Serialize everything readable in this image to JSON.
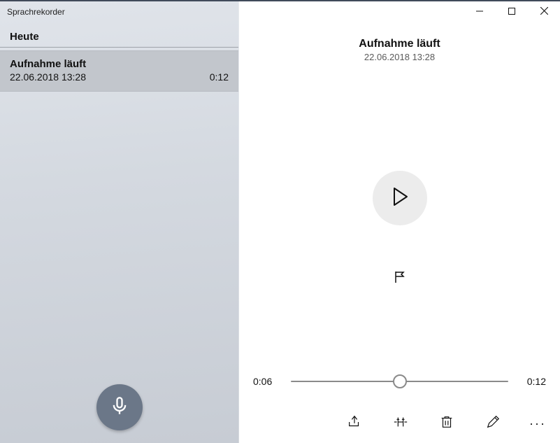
{
  "app_title": "Sprachrekorder",
  "sidebar": {
    "section_heading": "Heute",
    "recordings": [
      {
        "title": "Aufnahme läuft",
        "datetime": "22.06.2018 13:28",
        "duration": "0:12"
      }
    ]
  },
  "detail": {
    "title": "Aufnahme läuft",
    "datetime": "22.06.2018 13:28",
    "current_time": "0:06",
    "total_time": "0:12",
    "progress_percent": 50
  },
  "icons": {
    "record": "microphone-icon",
    "play": "play-icon",
    "flag": "flag-icon",
    "share": "share-icon",
    "trim": "trim-icon",
    "delete": "trash-icon",
    "rename": "pencil-icon",
    "more": "more-icon",
    "minimize": "minimize-icon",
    "maximize": "maximize-icon",
    "close": "close-icon"
  }
}
